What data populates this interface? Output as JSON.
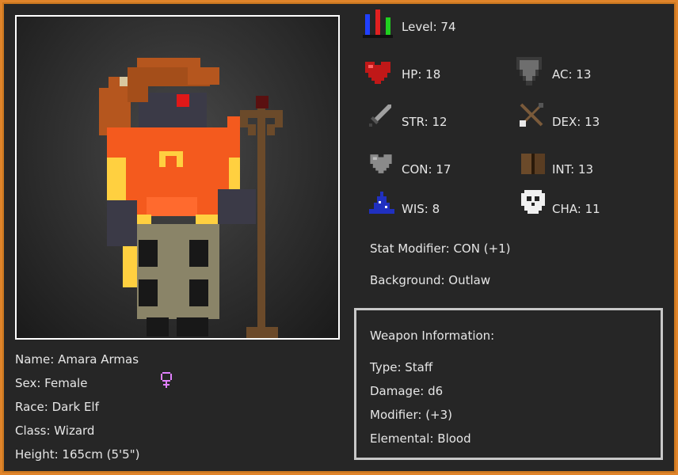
{
  "character": {
    "name": "Name: Amara Armas",
    "sex": "Sex: Female",
    "race": "Race: Dark Elf",
    "class": "Class: Wizard",
    "height": "Height: 165cm (5'5\")"
  },
  "stats": {
    "level": "Level: 74",
    "hp": "HP: 18",
    "ac": "AC: 13",
    "str": "STR: 12",
    "dex": "DEX: 13",
    "con": "CON: 17",
    "int": "INT: 13",
    "wis": "WIS: 8",
    "cha": "CHA: 11",
    "stat_modifier": "Stat Modifier: CON (+1)",
    "background": "Background: Outlaw"
  },
  "weapon": {
    "header": "Weapon Information:",
    "type": "Type: Staff",
    "damage": "Damage: d6",
    "modifier": "Modifier: (+3)",
    "elemental": "Elemental: Blood"
  },
  "icons": {
    "level": "bar-chart-icon",
    "hp": "heart-icon",
    "ac": "shield-icon",
    "str": "sword-icon",
    "dex": "crossbow-icon",
    "con": "grey-heart-icon",
    "int": "book-icon",
    "wis": "wizard-hat-icon",
    "cha": "skull-icon",
    "sex": "female-symbol-icon"
  },
  "colors": {
    "frame": "#e0842a",
    "panel": "#262626",
    "text": "#e6e6e6",
    "female_symbol": "#e080ff"
  }
}
